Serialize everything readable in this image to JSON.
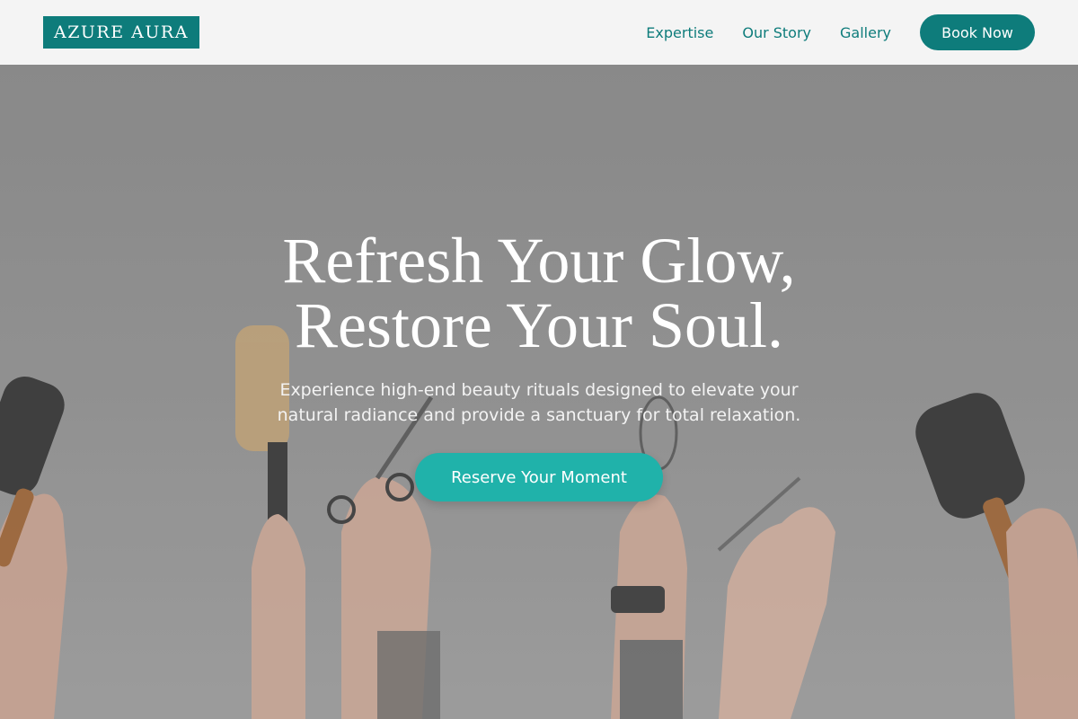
{
  "brand": {
    "logo_text": "AZURE AURA"
  },
  "nav": {
    "links": [
      "Expertise",
      "Our Story",
      "Gallery"
    ],
    "cta_label": "Book Now"
  },
  "hero": {
    "title_line1": "Refresh Your Glow,",
    "title_line2": "Restore Your Soul.",
    "subtitle_line1": "Experience high-end beauty rituals designed to elevate your",
    "subtitle_line2": "natural radiance and provide a sanctuary for total relaxation.",
    "cta_label": "Reserve Your Moment",
    "background_icon": "hair-tools-photo"
  },
  "colors": {
    "brand_teal": "#0e7c7b",
    "cta_teal": "#20b2aa",
    "header_bg": "#f4f4f4"
  }
}
